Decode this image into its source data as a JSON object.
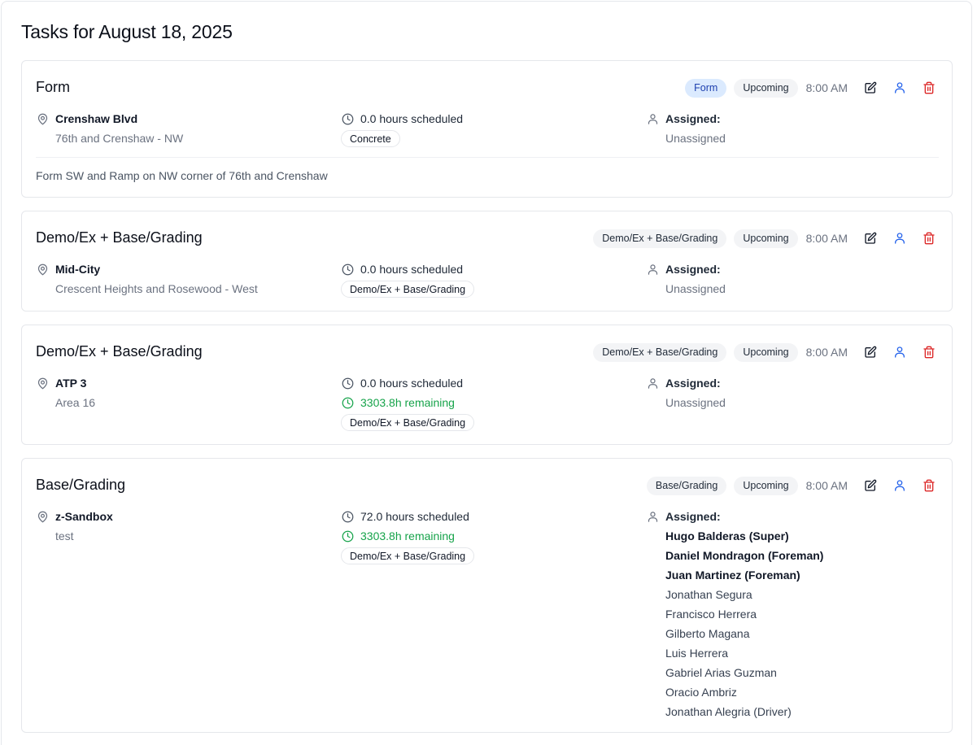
{
  "page": {
    "title": "Tasks for August 18, 2025"
  },
  "labels": {
    "assigned": "Assigned:"
  },
  "colors": {
    "accent_blue": "#2563eb",
    "delete_red": "#dc2626",
    "remaining_green": "#16a34a"
  },
  "icons": {
    "edit": "edit-icon",
    "assign": "user-icon",
    "delete": "trash-icon",
    "location": "map-pin-icon",
    "time": "clock-icon",
    "person": "user-icon"
  },
  "tasks": [
    {
      "title": "Form",
      "type_badge": "Form",
      "status": "Upcoming",
      "time": "8:00 AM",
      "location_name": "Crenshaw Blvd",
      "location_detail": "76th and Crenshaw - NW",
      "hours_scheduled": "0.0 hours scheduled",
      "tag": "Concrete",
      "assigned_value": "Unassigned",
      "notes": "Form SW and Ramp on NW corner of 76th and Crenshaw"
    },
    {
      "title": "Demo/Ex + Base/Grading",
      "type_badge": "Demo/Ex + Base/Grading",
      "status": "Upcoming",
      "time": "8:00 AM",
      "location_name": "Mid-City",
      "location_detail": "Crescent Heights and Rosewood - West",
      "hours_scheduled": "0.0 hours scheduled",
      "tag": "Demo/Ex + Base/Grading",
      "assigned_value": "Unassigned"
    },
    {
      "title": "Demo/Ex + Base/Grading",
      "type_badge": "Demo/Ex + Base/Grading",
      "status": "Upcoming",
      "time": "8:00 AM",
      "location_name": "ATP 3",
      "location_detail": "Area 16",
      "hours_scheduled": "0.0 hours scheduled",
      "remaining": "3303.8h remaining",
      "tag": "Demo/Ex + Base/Grading",
      "assigned_value": "Unassigned"
    },
    {
      "title": "Base/Grading",
      "type_badge": "Base/Grading",
      "status": "Upcoming",
      "time": "8:00 AM",
      "location_name": "z-Sandbox",
      "location_detail": "test",
      "hours_scheduled": "72.0 hours scheduled",
      "remaining": "3303.8h remaining",
      "tag": "Demo/Ex + Base/Grading",
      "assigned_people": [
        {
          "name": "Hugo Balderas (Super)",
          "lead": true
        },
        {
          "name": "Daniel Mondragon (Foreman)",
          "lead": true
        },
        {
          "name": "Juan Martinez (Foreman)",
          "lead": true
        },
        {
          "name": "Jonathan Segura",
          "lead": false
        },
        {
          "name": "Francisco Herrera",
          "lead": false
        },
        {
          "name": "Gilberto Magana",
          "lead": false
        },
        {
          "name": "Luis Herrera",
          "lead": false
        },
        {
          "name": "Gabriel Arias Guzman",
          "lead": false
        },
        {
          "name": "Oracio Ambriz",
          "lead": false
        },
        {
          "name": "Jonathan Alegria (Driver)",
          "lead": false
        }
      ]
    }
  ]
}
